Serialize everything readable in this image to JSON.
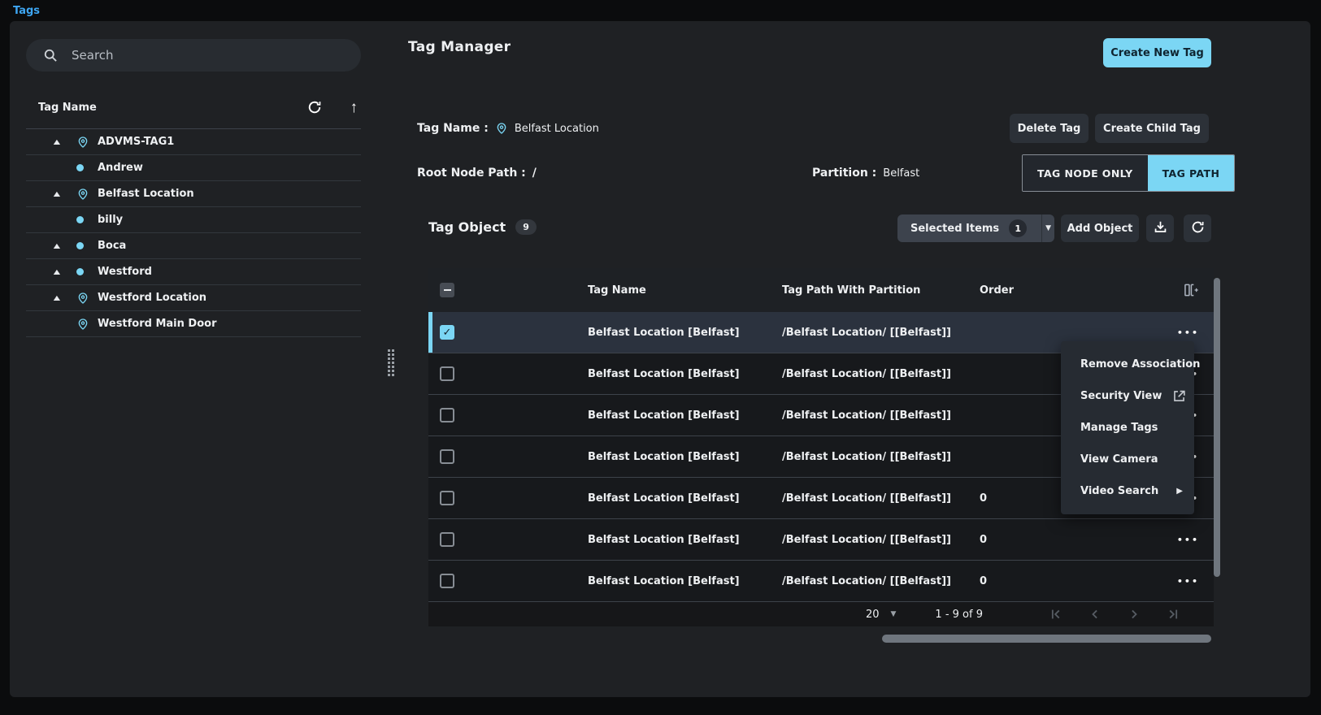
{
  "colors": {
    "accent": "#7bd6f4",
    "breadcrumb_link": "#3ea6f2",
    "panel_bg": "#1f2124",
    "selected_row_bg": "#2b323e"
  },
  "icons": {
    "collapse_arrow": "▲",
    "dropdown_arrow": "▼",
    "submenu_arrow": "▶",
    "sort_up_arrow": "↑",
    "ellipsis": "•••"
  },
  "topbar": {
    "breadcrumb": "Tags"
  },
  "sidebar": {
    "search_placeholder": "Search",
    "tree_header": "Tag Name",
    "items": [
      {
        "label": "ADVMS-TAG1",
        "icon": "pin",
        "expander": true,
        "indent": false
      },
      {
        "label": "Andrew",
        "icon": "dot",
        "expander": false,
        "indent": true
      },
      {
        "label": "Belfast Location",
        "icon": "pin",
        "expander": true,
        "indent": false
      },
      {
        "label": "billy",
        "icon": "dot",
        "expander": false,
        "indent": true
      },
      {
        "label": "Boca",
        "icon": "dot",
        "expander": true,
        "indent": false
      },
      {
        "label": "Westford",
        "icon": "dot",
        "expander": true,
        "indent": false
      },
      {
        "label": "Westford Location",
        "icon": "pin",
        "expander": true,
        "indent": false
      },
      {
        "label": "Westford Main Door",
        "icon": "pin",
        "expander": false,
        "indent": true
      }
    ]
  },
  "header": {
    "title": "Tag Manager",
    "create_new_tag": "Create New Tag"
  },
  "detail": {
    "tag_name_label": "Tag Name :",
    "tag_name_value": "Belfast Location",
    "delete_tag": "Delete Tag",
    "create_child_tag": "Create Child Tag",
    "root_node_path_label": "Root Node Path :",
    "root_node_path_value": "/",
    "partition_label": "Partition :",
    "partition_value": "Belfast",
    "toggle": {
      "options": [
        "TAG NODE ONLY",
        "TAG PATH"
      ],
      "active": "TAG PATH"
    }
  },
  "tag_object": {
    "title": "Tag Object",
    "count": "9",
    "selected_items_label": "Selected Items",
    "selected_count": "1",
    "add_object": "Add Object",
    "table": {
      "columns": [
        "Tag Name",
        "Tag Path With Partition",
        "Order"
      ],
      "rows": [
        {
          "tag_name": "Belfast Location [Belfast]",
          "tag_path": "/Belfast Location/ [[Belfast]]",
          "order": "",
          "checked": true,
          "selected": true
        },
        {
          "tag_name": "Belfast Location [Belfast]",
          "tag_path": "/Belfast Location/ [[Belfast]]",
          "order": "",
          "checked": false,
          "selected": false
        },
        {
          "tag_name": "Belfast Location [Belfast]",
          "tag_path": "/Belfast Location/ [[Belfast]]",
          "order": "",
          "checked": false,
          "selected": false
        },
        {
          "tag_name": "Belfast Location [Belfast]",
          "tag_path": "/Belfast Location/ [[Belfast]]",
          "order": "",
          "checked": false,
          "selected": false
        },
        {
          "tag_name": "Belfast Location [Belfast]",
          "tag_path": "/Belfast Location/ [[Belfast]]",
          "order": "0",
          "checked": false,
          "selected": false
        },
        {
          "tag_name": "Belfast Location [Belfast]",
          "tag_path": "/Belfast Location/ [[Belfast]]",
          "order": "0",
          "checked": false,
          "selected": false
        },
        {
          "tag_name": "Belfast Location [Belfast]",
          "tag_path": "/Belfast Location/ [[Belfast]]",
          "order": "0",
          "checked": false,
          "selected": false
        }
      ]
    },
    "pagination": {
      "page_size": "20",
      "range": "1 - 9 of 9"
    }
  },
  "context_menu": {
    "items": [
      {
        "label": "Remove Association",
        "icon": ""
      },
      {
        "label": "Security View",
        "icon": "external-link"
      },
      {
        "label": "Manage Tags",
        "icon": ""
      },
      {
        "label": "View Camera",
        "icon": ""
      },
      {
        "label": "Video Search",
        "icon": "submenu-arrow"
      }
    ]
  }
}
